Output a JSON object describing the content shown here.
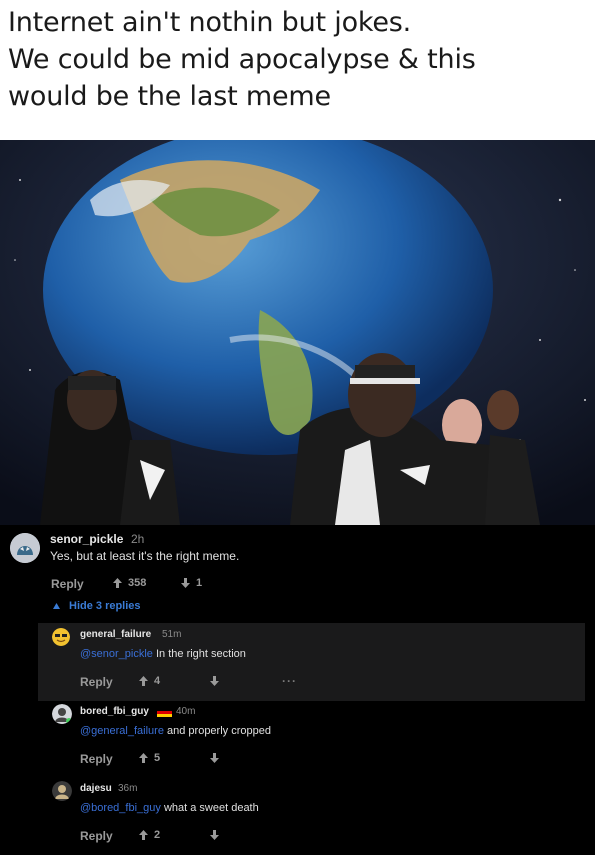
{
  "meme": {
    "caption_lines": [
      "Internet ain't nothin but jokes.",
      "We could be mid apocalypse & this",
      "would be the last meme"
    ]
  },
  "comments": {
    "top": {
      "username": "senor_pickle",
      "time": "2h",
      "body": "Yes, but at least it's the right meme.",
      "reply_label": "Reply",
      "upvotes": "358",
      "downvotes": "1",
      "hide_replies_label": "Hide 3 replies"
    },
    "replies": [
      {
        "username": "general_failure",
        "time": "51m",
        "mention": "@senor_pickle",
        "text": " In the right section",
        "reply_label": "Reply",
        "upvotes": "4",
        "more_label": "···"
      },
      {
        "username": "bored_fbi_guy",
        "time": "40m",
        "mention": "@general_failure",
        "text": " and properly cropped",
        "reply_label": "Reply",
        "upvotes": "5"
      },
      {
        "username": "dajesu",
        "time": "36m",
        "mention": "@bored_fbi_guy",
        "text": " what a sweet death",
        "reply_label": "Reply",
        "upvotes": "2"
      }
    ]
  },
  "colors": {
    "mention": "#3a6fd6",
    "action_gray": "#9a9a9a",
    "highlight_bg": "#1a1a1b"
  }
}
